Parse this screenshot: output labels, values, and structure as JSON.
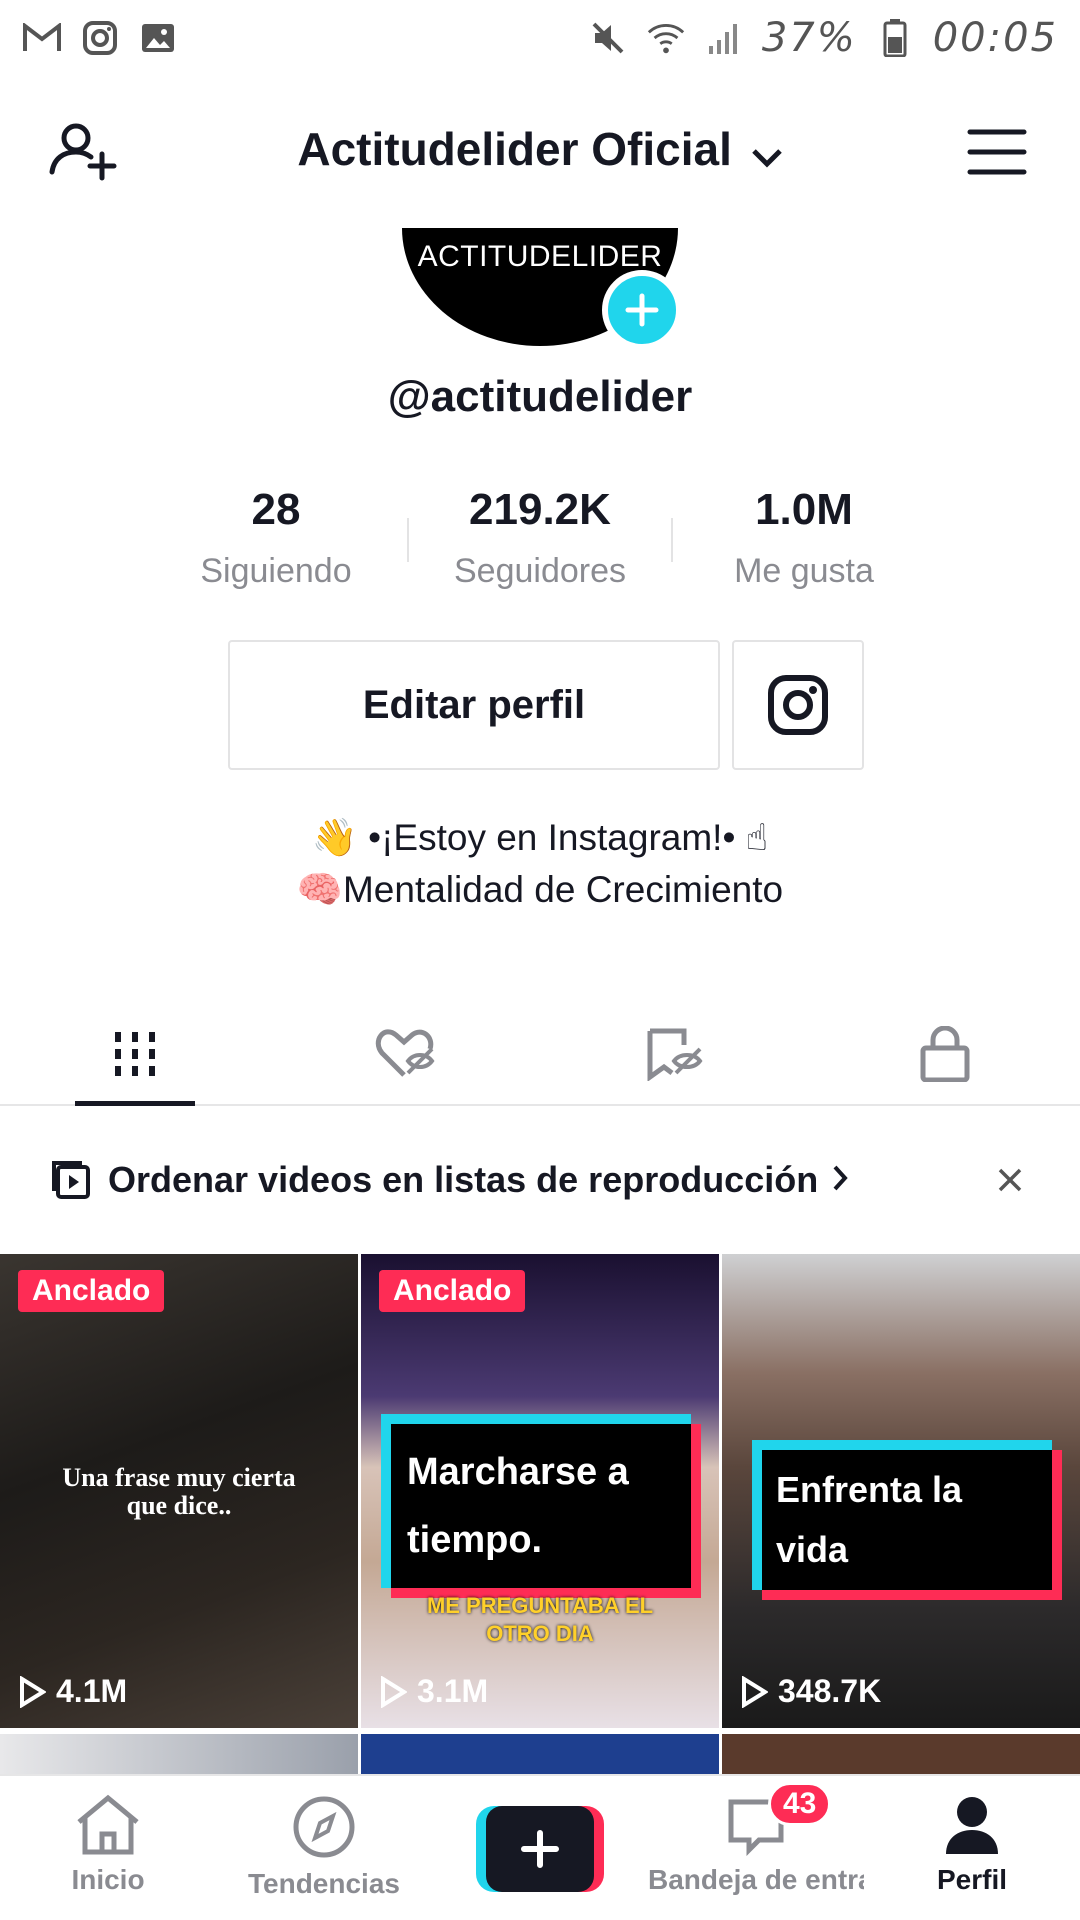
{
  "status_bar": {
    "left_icons": [
      "gmail-icon",
      "instagram-icon",
      "image-icon"
    ],
    "right_icons": [
      "mute-icon",
      "wifi-icon",
      "signal-icon",
      "battery-icon"
    ],
    "battery": "37%",
    "time": "00:05"
  },
  "header": {
    "title": "Actitudelider Oficial",
    "left_icon": "add-user-icon",
    "right_icon": "menu-icon"
  },
  "profile": {
    "avatar_text": "ACTITUDELIDER",
    "username": "@actitudelider",
    "stats": [
      {
        "value": "28",
        "label": "Siguiendo"
      },
      {
        "value": "219.2K",
        "label": "Seguidores"
      },
      {
        "value": "1.0M",
        "label": "Me gusta"
      }
    ],
    "edit_button": "Editar perfil",
    "bio_line1": "👋 •¡Estoy en Instagram!• ☝",
    "bio_line2": "🧠Mentalidad de Crecimiento"
  },
  "tabs": [
    "videos-grid-icon",
    "liked-hidden-icon",
    "favorites-hidden-icon",
    "private-lock-icon"
  ],
  "banner": {
    "text": "Ordenar videos en listas de reproducción"
  },
  "videos": [
    {
      "pinned": "Anclado",
      "caption": "Una frase muy cierta que dice..",
      "views": "4.1M"
    },
    {
      "pinned": "Anclado",
      "caption": "Marcharse a tiempo.",
      "subcaption": "ME PREGUNTABA EL OTRO DIA",
      "views": "3.1M"
    },
    {
      "caption": "Enfrenta la vida",
      "views": "348.7K"
    }
  ],
  "bottom_nav": {
    "home": "Inicio",
    "discover": "Tendencias",
    "inbox": "Bandeja de entra",
    "inbox_badge": "43",
    "profile": "Perfil"
  },
  "colors": {
    "accent_red": "#fe2c55",
    "accent_cyan": "#20d5ec",
    "text": "#161823",
    "muted": "#8a8b91"
  }
}
